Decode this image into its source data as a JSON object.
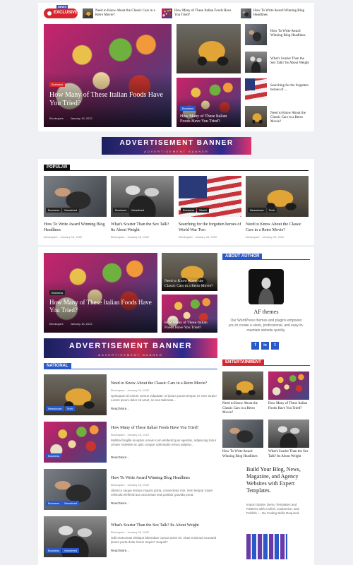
{
  "ticker": {
    "badge_news": "NEWS",
    "badge_label": "EXCLUSIVE",
    "items": [
      {
        "title": "Need to Know About the Classic Cars in a Retro Movie?"
      },
      {
        "title": "How Many of These Italian Foods Have You Tried?"
      },
      {
        "title": "How To Write Award Winning Blog Headlines"
      }
    ]
  },
  "hero": {
    "tag": "Business",
    "title": "How Many of These Italian Foods Have You Tried?",
    "author": "Blockspare",
    "date": "January 18, 2022"
  },
  "hero_side": {
    "tags": [
      "Business"
    ],
    "title": "How Many of These Italian Foods Have You Tried?"
  },
  "hero_list": [
    {
      "title": "How To Write Award Winning Blog Headlines"
    },
    {
      "title": "What's Scarier Than the Sex Talk? Its About Weight"
    },
    {
      "title": "Searching for the forgotten heroes of ..."
    },
    {
      "title": "Need to Know About the Classic Cars in a Retro Movie?"
    }
  ],
  "ad_banner": {
    "title": "ADVERTISEMENT BANNER",
    "sub": "ADVERTISEMENT BANNER"
  },
  "popular": {
    "heading": "POPULAR",
    "items": [
      {
        "tags": [
          "Business",
          "Newsfeed"
        ],
        "title": "How To Write Award Winning Blog Headlines",
        "author": "Blockspare",
        "date": "January 18, 2022"
      },
      {
        "tags": [
          "Business",
          "Newsfeed"
        ],
        "title": "What's Scarier Than the Sex Talk? Its About Weight",
        "author": "Blockspare",
        "date": "January 18, 2022"
      },
      {
        "tags": [
          "Business",
          "World"
        ],
        "title": "Searching for the forgotten heroes of World War Two",
        "author": "Blockspare",
        "date": "January 18, 2022"
      },
      {
        "tags": [
          "Newsdown",
          "Tech"
        ],
        "title": "Need to Know About the Classic Cars in a Retro Movie?",
        "author": "Blockspare",
        "date": "January 18, 2022"
      }
    ]
  },
  "main_feature": {
    "tag": "Business",
    "title": "How Many of These Italian Foods Have You Tried?",
    "author": "Blockspare",
    "date": "January 18, 2022"
  },
  "main_side": [
    {
      "title": "Need to Know About the Classic Cars in a Retro Movie?"
    },
    {
      "title": "How Many of These Italian Foods Have You Tried?"
    }
  ],
  "national": {
    "heading": "NATIONAL",
    "items": [
      {
        "tags": [
          "Newsdown",
          "Tech"
        ],
        "title": "Need to Know About the Classic Cars in a Retro Movie?",
        "author": "Blockspare",
        "date": "January 18, 2022",
        "excerpt": "Quisquam id rutrum cursus vulputate. Id ipsum purus tempor et. Nec turpis! Lorem ipsum dolor sit amet, so sea takimata...",
        "more": "Read More..."
      },
      {
        "tags": [
          "Business"
        ],
        "title": "How Many of These Italian Foods Have You Tried?",
        "author": "Blockspare",
        "date": "January 18, 2022",
        "excerpt": "Mollitia fringilla inceptos ornare cum eleifend quis egestas, adipiscing tortor ornare molestie ac quis congue sollicitudin minus adipisci...",
        "more": "Read More..."
      },
      {
        "tags": [
          "Business",
          "Newsfeed"
        ],
        "title": "How To Write Award Winning Blog Headlines",
        "author": "Blockspare",
        "date": "January 18, 2022",
        "excerpt": "Ullamco seque tempor mauris porta, consectetur iste, nem tempor totam vehicula eleifend aus accumsan sed porttitor gravida porta.",
        "more": "Read More..."
      },
      {
        "tags": [
          "Business",
          "Newsfeed"
        ],
        "title": "What's Scarier Than the Sex Talk? Its About Weight",
        "author": "Blockspare",
        "date": "January 18, 2022",
        "excerpt": "Odit maecenas tristique bibendum cursus amet sit, Vitae euismod ocusand ipsum porta dolor lorem tuquis? Sequel?",
        "more": "Read More..."
      }
    ]
  },
  "about": {
    "heading": "ABOUT AUTHOR",
    "name": "AF themes",
    "text": "Our WordPress themes and plugins empower you to create a sleek, professional, and easy-to-maintain website quickly.",
    "social": [
      "f",
      "in",
      "t"
    ]
  },
  "entertainment": {
    "heading": "ENTERTAINMENT",
    "items": [
      {
        "title": "Need to Know About the Classic Cars in a Retro Movie?"
      },
      {
        "title": "How Many of These Italian Foods Have You Tried?"
      },
      {
        "title": "How To Write Award Winning Blog Headlines"
      },
      {
        "title": "What's Scarier Than the Sex Talk? Its About Weight"
      }
    ]
  },
  "promo": {
    "title": "Build Your Blog, News, Magazine, and Agency Websites with Expert Templates.",
    "text": "Import Starter Demo Templates and Patterns with a Click, Customize, and Publish — No Coding Skills Required."
  },
  "colors": {
    "accent": "#d8262e",
    "blue": "#2a59c8"
  }
}
